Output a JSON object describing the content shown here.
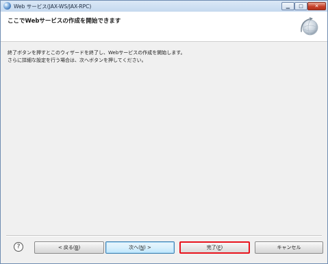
{
  "window": {
    "title": "Web サービス(JAX-WS/JAX-RPC)",
    "minimize_glyph": "▁",
    "maximize_glyph": "□",
    "close_glyph": "✕"
  },
  "banner": {
    "title": "ここでWebサービスの作成を開始できます",
    "icon": "wizard-globe-icon"
  },
  "content": {
    "line1": "終了ボタンを押すとこのウィザードを終了し、Webサービスの作成を開始します。",
    "line2": "さらに詳細な設定を行う場合は、次へボタンを押してください。"
  },
  "footer": {
    "help_glyph": "?",
    "back": {
      "prefix": "< 戻る(",
      "mnemonic": "B",
      "suffix": ")"
    },
    "next": {
      "prefix": "次へ(",
      "mnemonic": "N",
      "suffix": ") >"
    },
    "finish": {
      "prefix": "完了(",
      "mnemonic": "F",
      "suffix": ")"
    },
    "cancel": "キャンセル"
  },
  "colors": {
    "highlight_border": "#e8121c",
    "default_button_border": "#3c7fb1"
  }
}
